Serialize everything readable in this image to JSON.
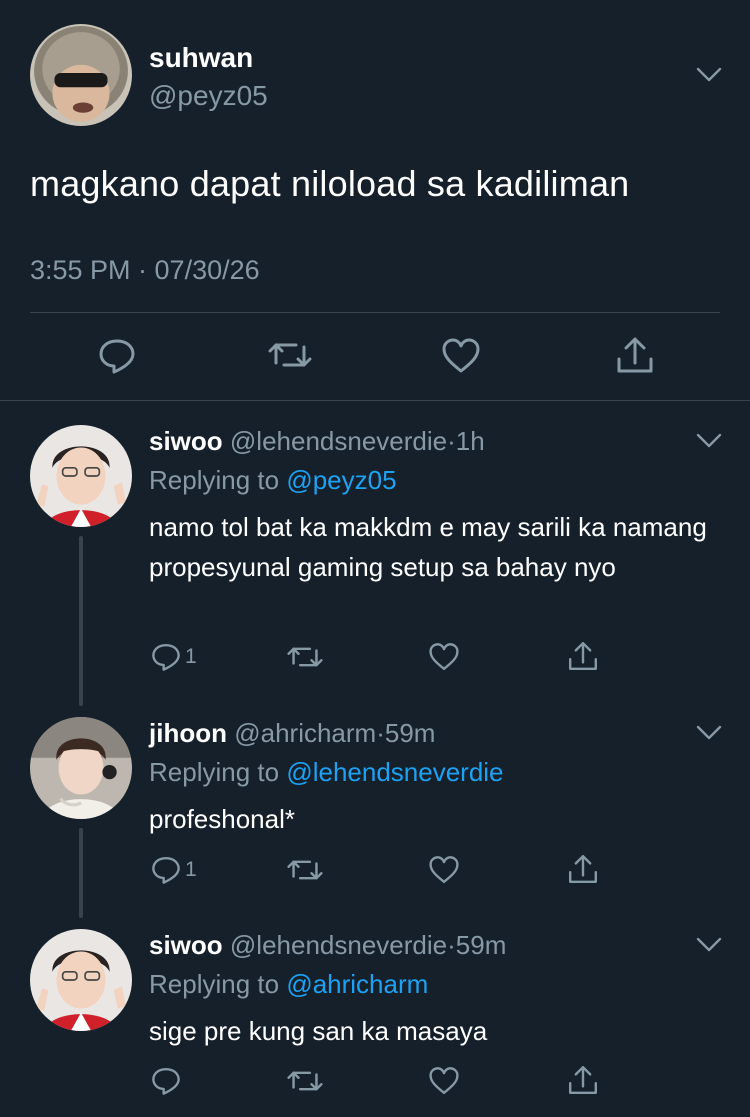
{
  "main_tweet": {
    "display_name": "suhwan",
    "handle": "@peyz05",
    "text": "magkano dapat niloload sa kadiliman",
    "timestamp": "3:55 PM · 07/30/26",
    "actions": [
      "reply-icon",
      "retweet-icon",
      "like-icon",
      "share-icon"
    ]
  },
  "replies": [
    {
      "display_name": "siwoo",
      "handle": "@lehendsneverdie",
      "separator": "·",
      "time": "1h",
      "replying_prefix": "Replying to ",
      "replying_to": "@peyz05",
      "text": "namo tol bat ka makkdm e may sarili ka namang propesyunal gaming setup sa bahay nyo",
      "reply_count": "1"
    },
    {
      "display_name": "jihoon",
      "handle": "@ahricharm",
      "separator": "·",
      "time": "59m",
      "replying_prefix": "Replying to ",
      "replying_to": "@lehendsneverdie",
      "text": "profeshonal*",
      "reply_count": "1"
    },
    {
      "display_name": "siwoo",
      "handle": "@lehendsneverdie",
      "separator": "·",
      "time": "59m",
      "replying_prefix": "Replying to ",
      "replying_to": "@ahricharm",
      "text": "sige pre kung san ka masaya",
      "reply_count": ""
    }
  ],
  "colors": {
    "background": "#15202b",
    "secondary_text": "#8899a6",
    "link": "#1da1f2",
    "divider": "#38444d"
  }
}
